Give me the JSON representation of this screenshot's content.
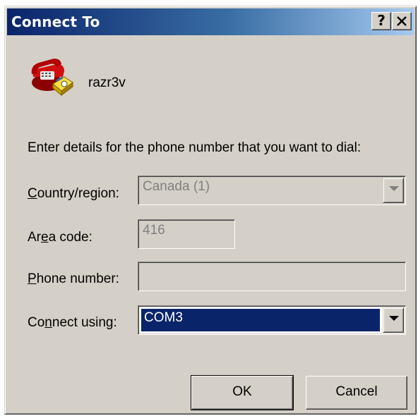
{
  "window": {
    "title": "Connect To",
    "help_glyph": "?",
    "close_glyph": "✕"
  },
  "connection": {
    "name": "razr3v",
    "icon": "phone-modem-icon"
  },
  "instructions": "Enter details for the phone number that you want to dial:",
  "form": {
    "country": {
      "label_prefix": "",
      "label_mnemonic": "C",
      "label_rest": "ountry/region:",
      "value": "Canada (1)"
    },
    "area": {
      "label_prefix": "Ar",
      "label_mnemonic": "e",
      "label_rest": "a code:",
      "value": "416"
    },
    "phone": {
      "label_prefix": "",
      "label_mnemonic": "P",
      "label_rest": "hone number:",
      "value": ""
    },
    "connect": {
      "label_prefix": "Co",
      "label_mnemonic": "n",
      "label_rest": "nect using:",
      "value": "COM3"
    }
  },
  "buttons": {
    "ok": "OK",
    "cancel": "Cancel"
  },
  "colors": {
    "title_start": "#0a246a",
    "title_end": "#a6caf0",
    "face": "#d4d0c8",
    "selection": "#0a246a"
  }
}
